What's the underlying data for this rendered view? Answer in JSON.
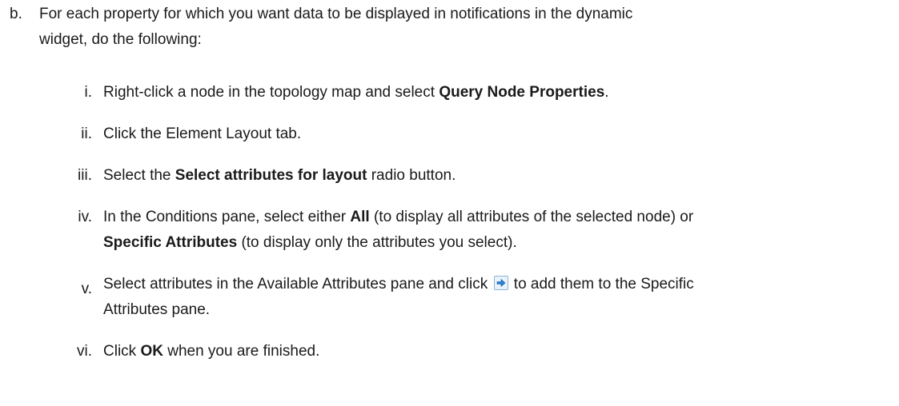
{
  "step_b": {
    "marker": "b.",
    "line1": "For each property for which you want data to be displayed in notifications in the dynamic",
    "line2": "widget, do the following:"
  },
  "substeps": {
    "s1": {
      "marker": "i.",
      "pre": "Right-click a node in the topology map and select ",
      "bold": "Query Node Properties",
      "post": "."
    },
    "s2": {
      "marker": "ii.",
      "text": "Click the Element Layout tab."
    },
    "s3": {
      "marker": "iii.",
      "pre": "Select the ",
      "bold": "Select attributes for layout",
      "post": " radio button."
    },
    "s4": {
      "marker": "iv.",
      "pre": "In the Conditions pane, select either ",
      "bold1": "All",
      "mid": " (to display all attributes of the selected node) or",
      "bold2": "Specific Attributes",
      "post": " (to display only the attributes you select)."
    },
    "s5": {
      "marker": "v.",
      "pre": "Select attributes in the Available Attributes pane and click ",
      "post": " to add them to the Specific",
      "line2": "Attributes pane.",
      "icon": "add-arrow-icon"
    },
    "s6": {
      "marker": "vi.",
      "pre": "Click ",
      "bold": "OK",
      "post": " when you are finished."
    }
  },
  "colors": {
    "text": "#1a1a1a",
    "icon_arrow": "#2b7fd3",
    "icon_bg": "#eaf3fb"
  }
}
